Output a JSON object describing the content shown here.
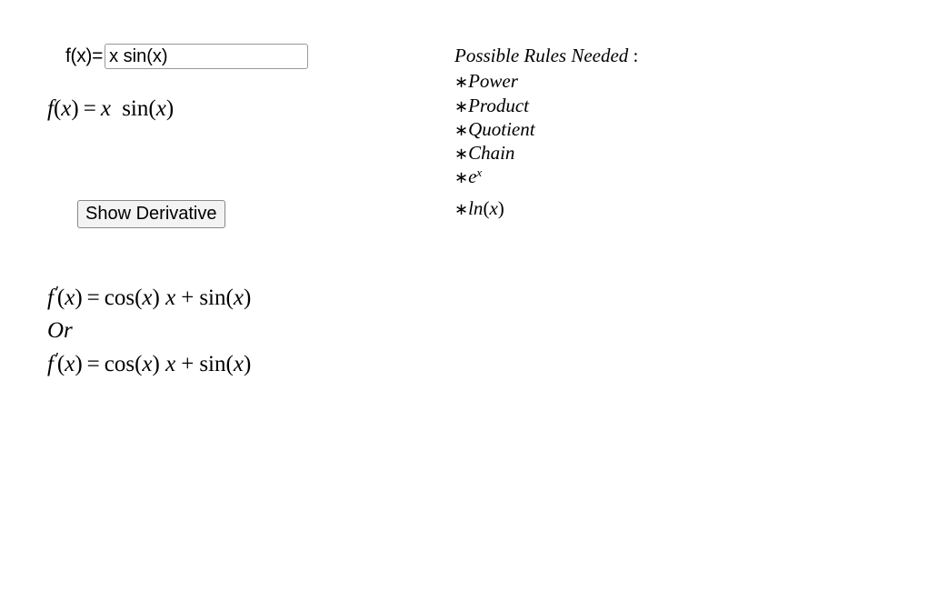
{
  "input": {
    "label": "f(x)=",
    "value": "x sin(x)"
  },
  "function_display": {
    "f": "f",
    "x": "x",
    "rhs_x": "x",
    "sin": "sin",
    "inner_x": "x"
  },
  "button": {
    "label": "Show Derivative"
  },
  "derivative": {
    "line1": {
      "f": "f",
      "x": "x",
      "cos": "cos",
      "cos_arg": "x",
      "term_x": "x",
      "sin": "sin",
      "sin_arg": "x"
    },
    "or": "Or",
    "line2": {
      "f": "f",
      "x": "x",
      "cos": "cos",
      "cos_arg": "x",
      "term_x": "x",
      "sin": "sin",
      "sin_arg": "x"
    }
  },
  "rules": {
    "title": "Possible Rules Needed",
    "items": {
      "power": "Power",
      "product": "Product",
      "quotient": "Quotient",
      "chain": "Chain",
      "e": "e",
      "e_sup": "x",
      "ln": "ln",
      "ln_arg": "x"
    }
  }
}
